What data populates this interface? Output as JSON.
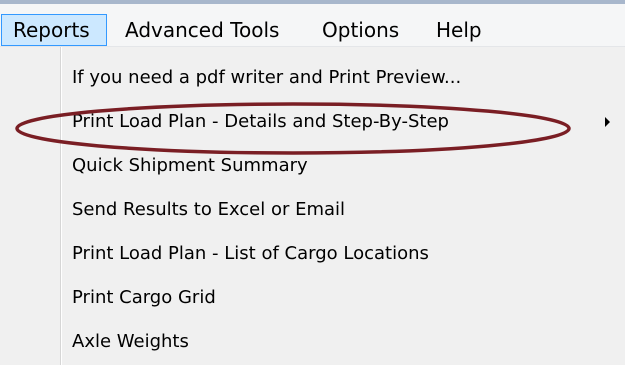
{
  "menubar": {
    "items": [
      {
        "label": "Reports",
        "active": true
      },
      {
        "label": "Advanced Tools",
        "active": false
      },
      {
        "label": "Options",
        "active": false
      },
      {
        "label": "Help",
        "active": false
      }
    ]
  },
  "dropdown": {
    "items": [
      {
        "label": "If you need a pdf writer and Print Preview...",
        "has_submenu": false
      },
      {
        "label": "Print Load Plan - Details and Step-By-Step",
        "has_submenu": true,
        "highlighted": true
      },
      {
        "label": "Quick Shipment Summary",
        "has_submenu": false
      },
      {
        "label": "Send Results to Excel or Email",
        "has_submenu": false
      },
      {
        "label": "Print Load Plan - List of Cargo Locations",
        "has_submenu": false
      },
      {
        "label": "Print Cargo Grid",
        "has_submenu": false
      },
      {
        "label": "Axle Weights",
        "has_submenu": false
      }
    ]
  },
  "colors": {
    "highlight_ellipse": "#7a1e24",
    "active_menu_bg": "#cce8ff",
    "active_menu_border": "#3399ff",
    "dropdown_bg": "#f0f0f0"
  },
  "icons": {
    "submenu_arrow": "chevron-right-icon"
  }
}
